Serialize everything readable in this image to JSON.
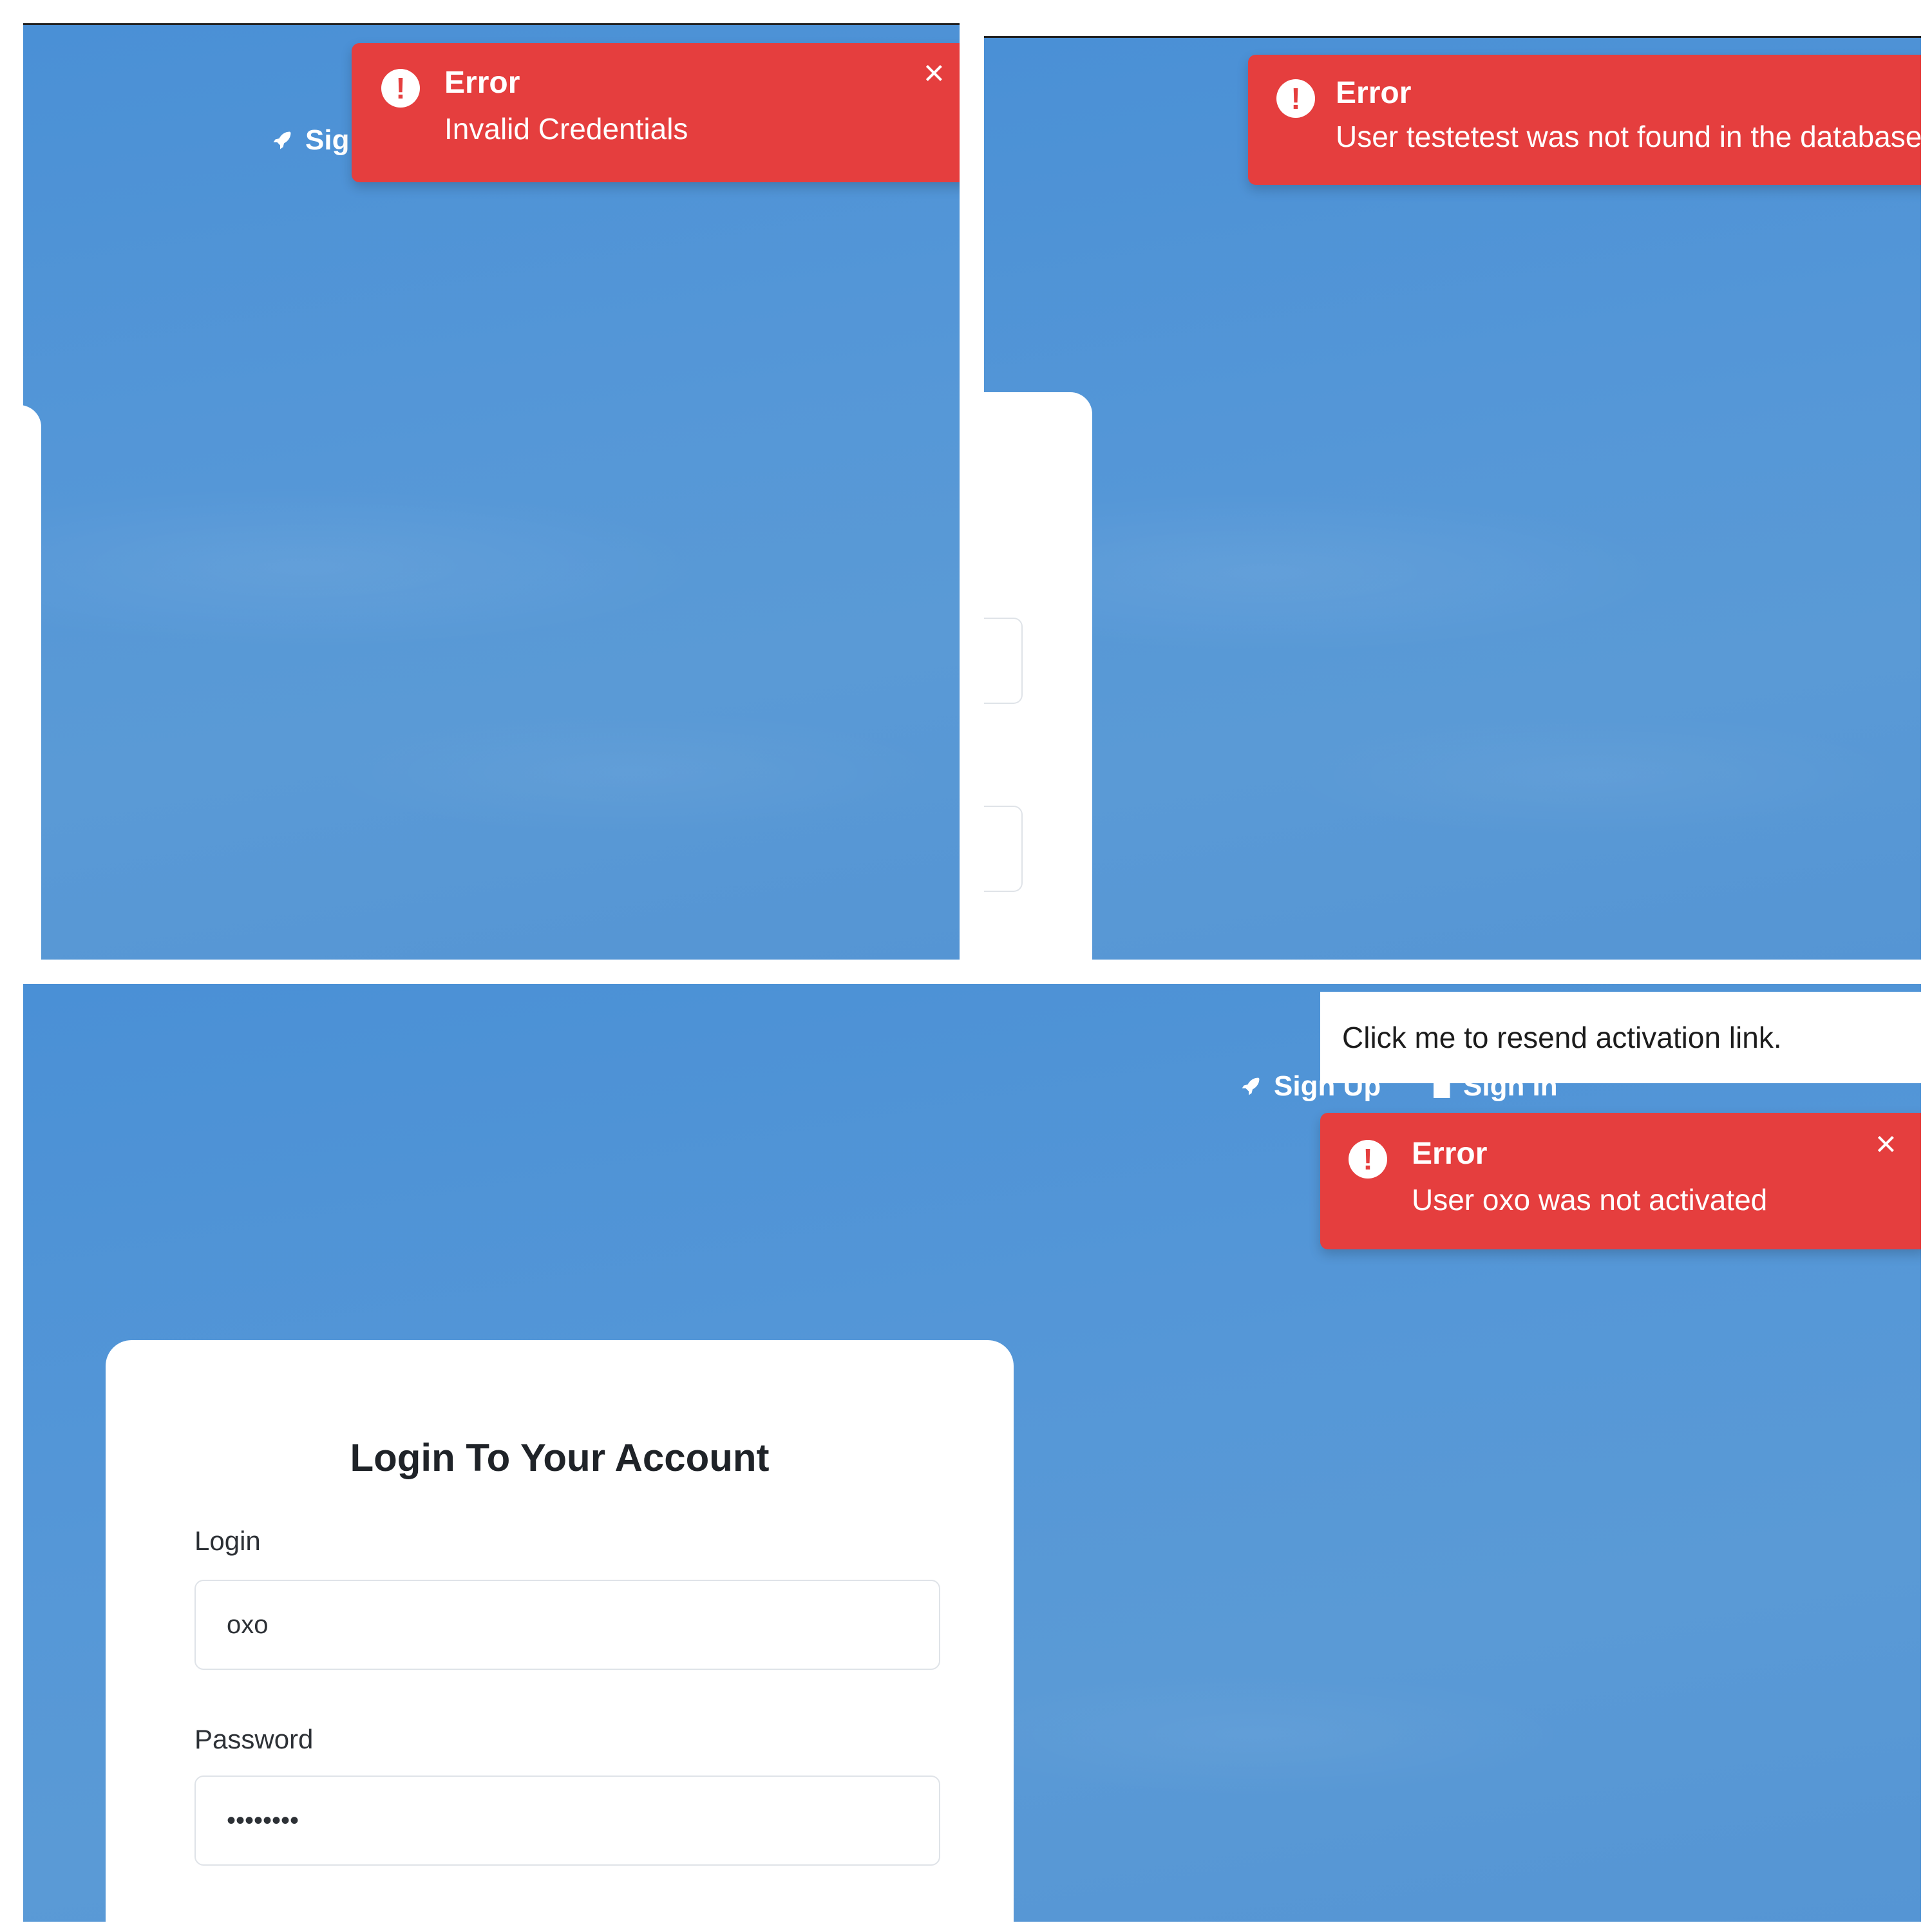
{
  "nav": {
    "sign_up": "Sign Up",
    "sign_up_cut": "Sig",
    "sign_in": "Sign In"
  },
  "toasts": [
    {
      "title": "Error",
      "message": "Invalid Credentials",
      "icon": "exclamation-circle-icon",
      "close": "×"
    },
    {
      "title": "Error",
      "message": "User testetest was not found in the database",
      "icon": "exclamation-circle-icon"
    },
    {
      "title": "Error",
      "message": "User oxo was not activated",
      "icon": "exclamation-circle-icon",
      "close": "×"
    }
  ],
  "resend_link": "Click me to resend activation link.",
  "login_form": {
    "title": "Login To Your Account",
    "login_label": "Login",
    "login_value": "oxo",
    "password_label": "Password",
    "password_value": "••••••••"
  },
  "colors": {
    "background": "#4a90d6",
    "toast": "#e53e3e",
    "card": "#ffffff"
  }
}
